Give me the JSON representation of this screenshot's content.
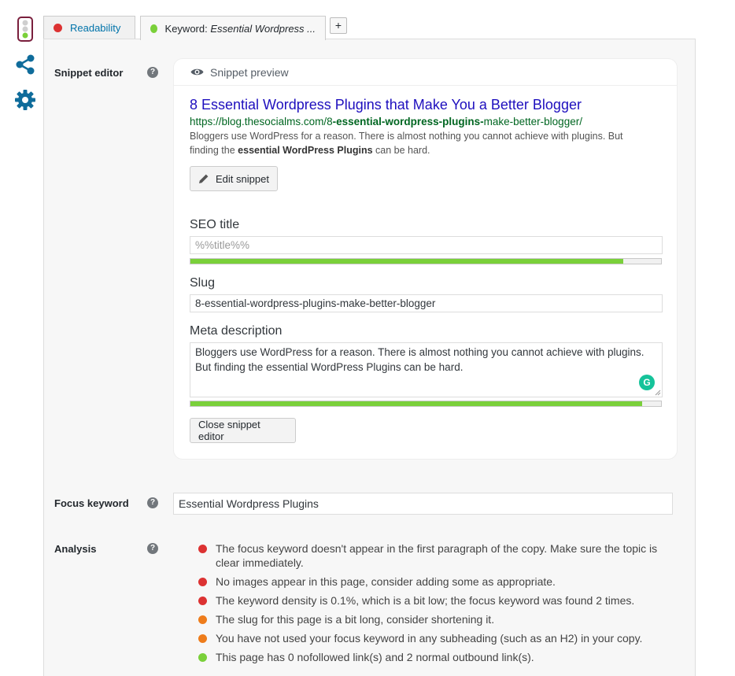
{
  "colors": {
    "bad": "#dc3232",
    "ok": "#ee7c1b",
    "good": "#7ad03a",
    "link": "#1e0fbe",
    "url": "#006621"
  },
  "icons": {
    "traffic": "traffic-light-icon",
    "share": "share-icon",
    "gear": "gear-icon",
    "eye": "eye-icon",
    "pencil": "pencil-icon",
    "help": "question-circle-icon"
  },
  "tabs": {
    "readability_label": "Readability",
    "keyword_prefix": "Keyword: ",
    "keyword_value": "Essential Wordpress ...",
    "add_label": "+"
  },
  "snippet": {
    "label": "Snippet editor",
    "help_glyph": "?",
    "preview_header": "Snippet preview",
    "preview_title": "8 Essential Wordpress Plugins that Make You a Better Blogger",
    "url_prefix": "https://blog.thesocialms.com/8",
    "url_bold": "-essential-wordpress-plugins-",
    "url_suffix": "make-better-blogger/",
    "desc_part1": "Bloggers use WordPress for a reason. There is almost nothing you cannot achieve with plugins. But finding the ",
    "desc_bold": "essential WordPress Plugins",
    "desc_part2": " can be hard.",
    "edit_button": "Edit snippet",
    "seo_title_label": "SEO title",
    "seo_title_placeholder": "%%title%%",
    "seo_title_progress": 0.92,
    "slug_label": "Slug",
    "slug_value": "8-essential-wordpress-plugins-make-better-blogger",
    "meta_label": "Meta description",
    "meta_value": "Bloggers use WordPress for a reason. There is almost nothing you cannot achieve with plugins. But finding the essential WordPress Plugins can be hard.",
    "meta_progress": 0.96,
    "grammarly_glyph": "G",
    "close_button": "Close snippet editor"
  },
  "focus": {
    "label": "Focus keyword",
    "help_glyph": "?",
    "value": "Essential Wordpress Plugins"
  },
  "analysis": {
    "label": "Analysis",
    "help_glyph": "?",
    "items": [
      {
        "status": "bad",
        "text": "The focus keyword doesn't appear in the first paragraph of the copy. Make sure the topic is clear immediately."
      },
      {
        "status": "bad",
        "text": "No images appear in this page, consider adding some as appropriate."
      },
      {
        "status": "bad",
        "text": "The keyword density is 0.1%, which is a bit low; the focus keyword was found 2 times."
      },
      {
        "status": "ok",
        "text": "The slug for this page is a bit long, consider shortening it."
      },
      {
        "status": "ok",
        "text": "You have not used your focus keyword in any subheading (such as an H2) in your copy."
      },
      {
        "status": "good",
        "text": "This page has 0 nofollowed link(s) and 2 normal outbound link(s)."
      }
    ]
  }
}
